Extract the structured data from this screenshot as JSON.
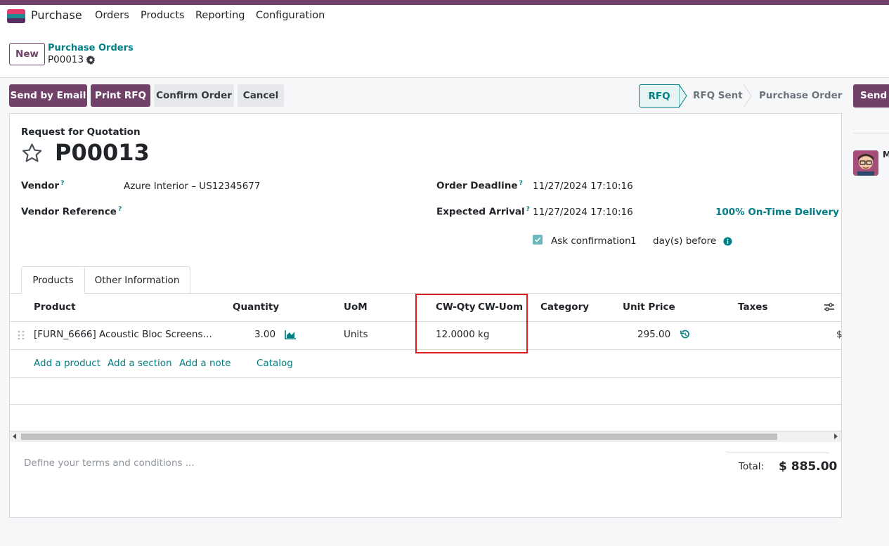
{
  "app": {
    "name": "Purchase",
    "menu": [
      "Orders",
      "Products",
      "Reporting",
      "Configuration"
    ]
  },
  "control_panel": {
    "new_label": "New",
    "breadcrumb_parent": "Purchase Orders",
    "breadcrumb_current": "P00013"
  },
  "actions": {
    "send_by_email": "Send by Email",
    "print_rfq": "Print RFQ",
    "confirm_order": "Confirm Order",
    "cancel": "Cancel",
    "send_partial": "Send m"
  },
  "statusbar": {
    "stages": [
      "RFQ",
      "RFQ Sent",
      "Purchase Order"
    ],
    "active": "RFQ"
  },
  "form": {
    "doc_type": "Request for Quotation",
    "name": "P00013",
    "vendor_label": "Vendor",
    "vendor_value": "Azure Interior – US12345677",
    "vendor_ref_label": "Vendor Reference",
    "deadline_label": "Order Deadline",
    "deadline_value": "11/27/2024 17:10:16",
    "arrival_label": "Expected Arrival",
    "arrival_value": "11/27/2024 17:10:16",
    "on_time": "100% On-Time Delivery",
    "ask_confirmation_label": "Ask confirmation",
    "ask_confirmation_days": "1",
    "days_before": "day(s) before",
    "help_mark": "?"
  },
  "tabs": [
    "Products",
    "Other Information"
  ],
  "table": {
    "headers": {
      "product": "Product",
      "quantity": "Quantity",
      "uom": "UoM",
      "cw_qty": "CW-Qty",
      "cw_uom": "CW-Uom",
      "category": "Category",
      "unit_price": "Unit Price",
      "taxes": "Taxes"
    },
    "rows": [
      {
        "product": "[FURN_6666] Acoustic Bloc Screens…",
        "quantity": "3.00",
        "uom": "Units",
        "cw_qty": "12.0000",
        "cw_uom": "kg",
        "category": "",
        "unit_price": "295.00",
        "taxes": "",
        "subtotal_partial": "$"
      }
    ],
    "add_product": "Add a product",
    "add_section": "Add a section",
    "add_note": "Add a note",
    "catalog": "Catalog"
  },
  "footer": {
    "terms_placeholder": "Define your terms and conditions ...",
    "total_label": "Total:",
    "total_value": "$ 885.00"
  },
  "colors": {
    "brand": "#71416a",
    "accent": "#017e84",
    "highlight": "#e01b24"
  }
}
